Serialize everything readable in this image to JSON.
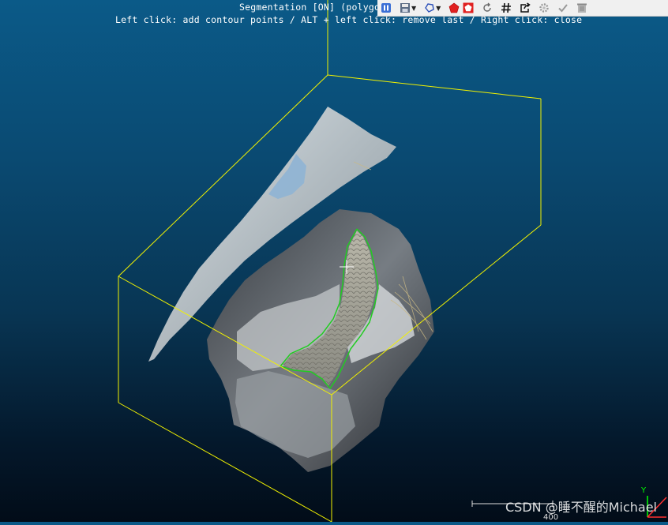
{
  "overlay": {
    "title": "Segmentation [ON] (polygonal)",
    "help": "Left click: add contour points / ALT + left click: remove last / Right click: close"
  },
  "toolbar": {
    "buttons": [
      {
        "name": "pause-icon",
        "label": "pause"
      },
      {
        "name": "save-icon",
        "label": "save"
      },
      {
        "name": "polygon-select-icon",
        "label": "polygon"
      },
      {
        "name": "segment-in-icon",
        "label": "segment in"
      },
      {
        "name": "segment-out-icon",
        "label": "segment out"
      },
      {
        "name": "reset-icon",
        "label": "reset"
      },
      {
        "name": "hash-icon",
        "label": "#"
      },
      {
        "name": "export-icon",
        "label": "export"
      },
      {
        "name": "gear-icon",
        "label": "settings"
      },
      {
        "name": "check-icon",
        "label": "confirm"
      },
      {
        "name": "trash-icon",
        "label": "cancel"
      }
    ]
  },
  "scale": {
    "label": "400"
  },
  "axis": {
    "y_label": "Y"
  },
  "watermark": "CSDN @睡不醒的Michael",
  "colors": {
    "bbox": "#f2f200",
    "contour": "#22cc22",
    "toolbar_bg": "#f0f0f0"
  }
}
